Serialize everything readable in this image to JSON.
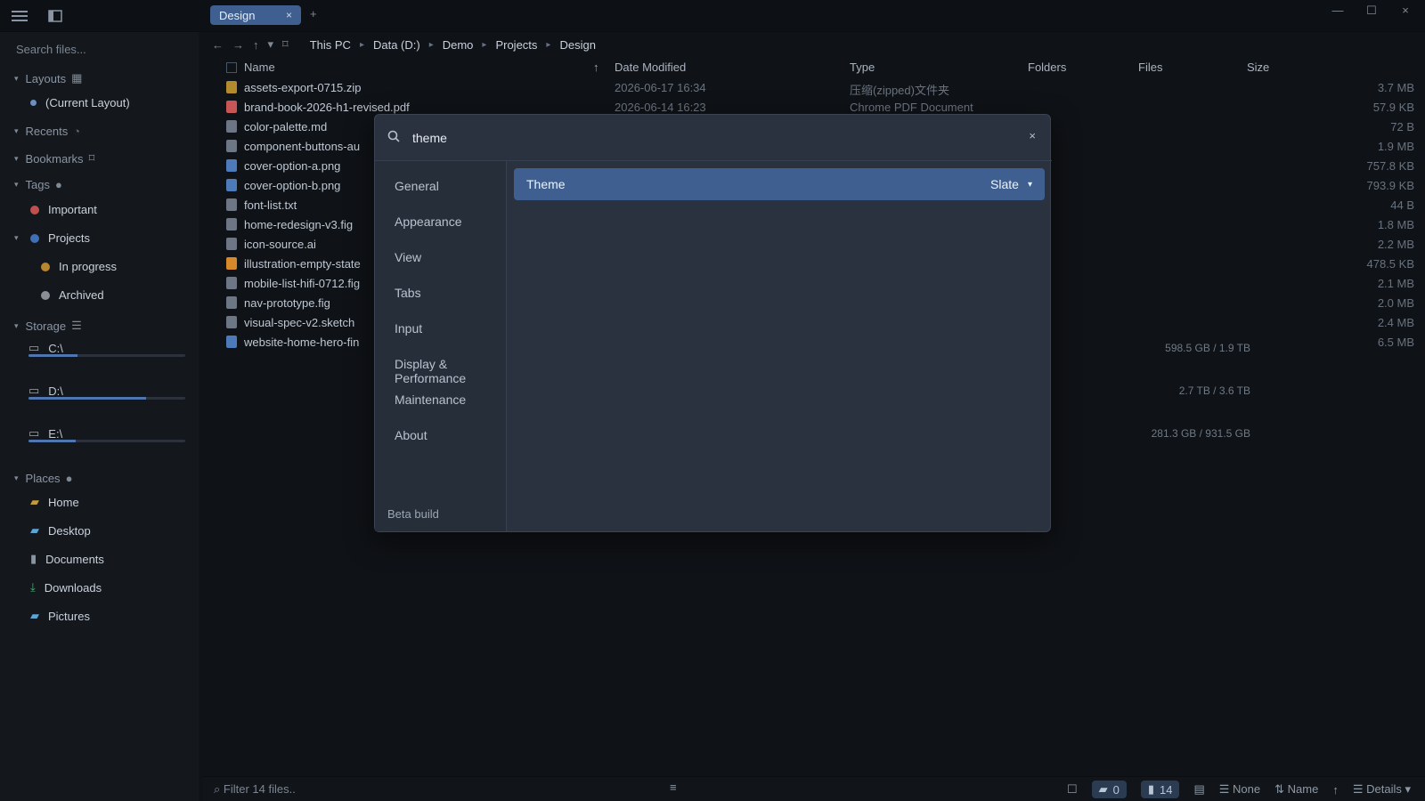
{
  "window": {
    "tab_label": "Design",
    "tab_close": "×",
    "new_tab": "+",
    "controls": {
      "minimize": "—",
      "maximize": "☐",
      "close": "×"
    }
  },
  "navigation": {
    "breadcrumbs": [
      "This PC",
      "Data (D:)",
      "Demo",
      "Projects",
      "Design"
    ]
  },
  "sidebar": {
    "search_placeholder": "Search files...",
    "layouts": {
      "title": "Layouts",
      "item": "(Current Layout)"
    },
    "recents_title": "Recents",
    "bookmarks_title": "Bookmarks",
    "tags": {
      "title": "Tags",
      "items": [
        {
          "label": "Important",
          "color": "#c0504d"
        },
        {
          "label": "Projects",
          "color": "#3f6fb5"
        },
        {
          "label": "In progress",
          "color": "#b9852e"
        },
        {
          "label": "Archived",
          "color": "#8a8f96"
        }
      ]
    },
    "storage": {
      "title": "Storage",
      "drives": [
        {
          "name": "C:\\",
          "size": "598.5 GB / 1.9 TB",
          "fill": 0.31
        },
        {
          "name": "D:\\",
          "size": "2.7 TB / 3.6 TB",
          "fill": 0.75
        },
        {
          "name": "E:\\",
          "size": "281.3 GB / 931.5 GB",
          "fill": 0.3
        }
      ]
    },
    "places": {
      "title": "Places",
      "items": [
        "Home",
        "Desktop",
        "Documents",
        "Downloads",
        "Pictures"
      ]
    }
  },
  "file_list": {
    "headers": {
      "name": "Name",
      "sort_arrow": "↑",
      "date_modified": "Date Modified",
      "type": "Type",
      "folders": "Folders",
      "files": "Files",
      "size": "Size"
    },
    "rows": [
      {
        "name": "assets-export-0715.zip",
        "date": "2026-06-17 16:34",
        "type": "压缩(zipped)文件夹",
        "size": "3.7 MB"
      },
      {
        "name": "brand-book-2026-h1-revised.pdf",
        "date": "2026-06-14 16:23",
        "type": "Chrome PDF Document",
        "size": "57.9 KB"
      },
      {
        "name": "color-palette.md",
        "date": "",
        "type": "",
        "size": "72 B"
      },
      {
        "name": "component-buttons-au",
        "date": "",
        "type": "",
        "size": "1.9 MB"
      },
      {
        "name": "cover-option-a.png",
        "date": "",
        "type": "",
        "size": "757.8 KB"
      },
      {
        "name": "cover-option-b.png",
        "date": "",
        "type": "",
        "size": "793.9 KB"
      },
      {
        "name": "font-list.txt",
        "date": "",
        "type": "",
        "size": "44 B"
      },
      {
        "name": "home-redesign-v3.fig",
        "date": "",
        "type": "",
        "size": "1.8 MB"
      },
      {
        "name": "icon-source.ai",
        "date": "",
        "type": "",
        "size": "2.2 MB"
      },
      {
        "name": "illustration-empty-state",
        "date": "",
        "type": "",
        "size": "478.5 KB"
      },
      {
        "name": "mobile-list-hifi-0712.fig",
        "date": "",
        "type": "",
        "size": "2.1 MB"
      },
      {
        "name": "nav-prototype.fig",
        "date": "",
        "type": "",
        "size": "2.0 MB"
      },
      {
        "name": "visual-spec-v2.sketch",
        "date": "",
        "type": "",
        "size": "2.4 MB"
      },
      {
        "name": "website-home-hero-fin",
        "date": "",
        "type": "",
        "size": "6.5 MB"
      }
    ]
  },
  "settings_modal": {
    "search_value": "theme",
    "close": "×",
    "categories": [
      "General",
      "Appearance",
      "View",
      "Tabs",
      "Input",
      "Display & Performance",
      "Maintenance",
      "About"
    ],
    "beta_label": "Beta build",
    "result": {
      "label": "Theme",
      "value": "Slate"
    }
  },
  "statusbar": {
    "filter_placeholder": "Filter 14 files..",
    "folder_count": "0",
    "file_count": "14",
    "group": "None",
    "sort": "Name",
    "sort_arrow": "↑",
    "view": "Details"
  }
}
